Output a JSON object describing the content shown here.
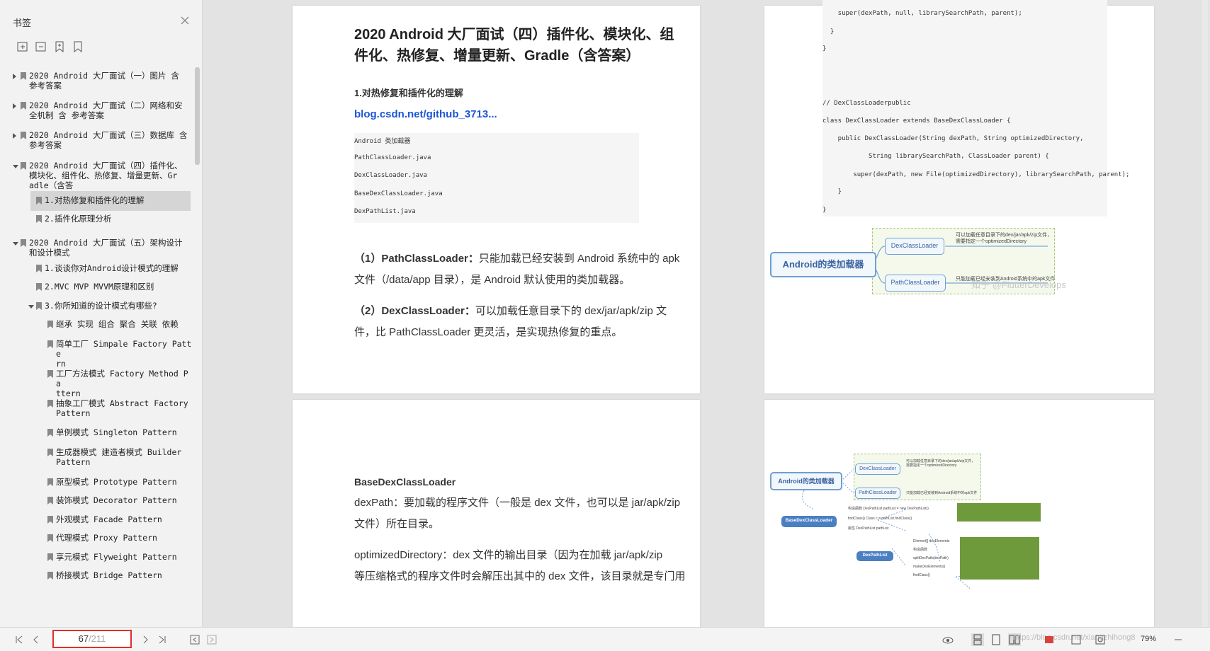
{
  "sidebar": {
    "title": "书签",
    "tools": [
      "expand-all-icon",
      "collapse-all-icon",
      "add-bookmark-icon",
      "bookmark-icon"
    ],
    "items": [
      {
        "text": "2020 Android 大厂面试（一）图片 含\n参考答案",
        "level": 0,
        "arrow": "right"
      },
      {
        "text": "2020 Android 大厂面试（二）网络和安\n全机制 含 参考答案",
        "level": 0,
        "arrow": "right"
      },
      {
        "text": "2020 Android 大厂面试（三）数据库 含\n参考答案",
        "level": 0,
        "arrow": "right"
      },
      {
        "text": "2020 Android 大厂面试（四）插件化、\n模块化、组件化、热修复、增量更新、Gr\nadle（含答",
        "level": 0,
        "arrow": "down"
      },
      {
        "text": "1.对热修复和插件化的理解",
        "level": 1,
        "arrow": "",
        "selected": true
      },
      {
        "text": "2.插件化原理分析",
        "level": 1,
        "arrow": ""
      },
      {
        "text": "2020 Android 大厂面试（五）架构设计\n和设计模式",
        "level": 0,
        "arrow": "down"
      },
      {
        "text": "1.谈谈你对Android设计模式的理解",
        "level": 1,
        "arrow": ""
      },
      {
        "text": "2.MVC MVP MVVM原理和区别",
        "level": 1,
        "arrow": ""
      },
      {
        "text": "3.你所知道的设计模式有哪些?",
        "level": 1,
        "arrow": "down"
      },
      {
        "text": "继承 实现 组合 聚合 关联 依赖",
        "level": 2,
        "arrow": ""
      },
      {
        "text": "简单工厂 Simpale Factory Patte\nrn",
        "level": 2,
        "arrow": ""
      },
      {
        "text": "工厂方法模式 Factory Method Pa\nttern",
        "level": 2,
        "arrow": ""
      },
      {
        "text": "抽象工厂模式 Abstract Factory\nPattern",
        "level": 2,
        "arrow": ""
      },
      {
        "text": "单例模式 Singleton Pattern",
        "level": 2,
        "arrow": ""
      },
      {
        "text": "生成器模式 建造者模式 Builder\nPattern",
        "level": 2,
        "arrow": ""
      },
      {
        "text": "原型模式 Prototype Pattern",
        "level": 2,
        "arrow": ""
      },
      {
        "text": "装饰模式 Decorator Pattern",
        "level": 2,
        "arrow": ""
      },
      {
        "text": "外观模式 Facade Pattern",
        "level": 2,
        "arrow": ""
      },
      {
        "text": "代理模式 Proxy Pattern",
        "level": 2,
        "arrow": ""
      },
      {
        "text": "享元模式 Flyweight Pattern",
        "level": 2,
        "arrow": ""
      },
      {
        "text": "桥接模式 Bridge Pattern",
        "level": 2,
        "arrow": ""
      }
    ]
  },
  "page1": {
    "title_l1": "2020 Android  大厂面试（四）插件化、模块化、组",
    "title_l2": "件化、热修复、增量更新、Gradle（含答案）",
    "section": "1.对热修复和插件化的理解",
    "link": "blog.csdn.net/github_3713...",
    "code": [
      "Android 类加载器",
      "PathClassLoader.java",
      "DexClassLoader.java",
      "BaseDexClassLoader.java",
      "DexPathList.java"
    ],
    "p1_bold": "（1）PathClassLoader：",
    "p1_l1": "只能加载已经安装到 Android 系统中的 apk",
    "p1_l2": "文件（/data/app 目录），是 Android 默认使用的类加载器。",
    "p2_bold": "（2）DexClassLoader：",
    "p2_l1": "可以加载任意目录下的 dex/jar/apk/zip 文",
    "p2_l2": "件，比 PathClassLoader 更灵活，是实现热修复的重点。"
  },
  "page2": {
    "code": [
      "    super(dexPath, null, librarySearchPath, parent);",
      "  }",
      "}",
      "",
      "",
      "// DexClassLoaderpublic",
      "class DexClassLoader extends BaseDexClassLoader {",
      "    public DexClassLoader(String dexPath, String optimizedDirectory,",
      "            String librarySearchPath, ClassLoader parent) {",
      "        super(dexPath, new File(optimizedDirectory), librarySearchPath, parent);",
      "    }",
      "}"
    ],
    "diagram": {
      "root": "Android的类加载器",
      "child1": "DexClassLoader",
      "child2": "PathClassLoader",
      "note1": "可以加载任意目录下的dex/jar/apk/zip文件，\n需要指定一个optimizedDirectory",
      "note2": "只能加载已经安装到Android系统中的apk文件",
      "watermark": "知乎 @FlutterDevelops"
    }
  },
  "page3": {
    "heading": "BaseDexClassLoader",
    "l1": "dexPath：要加载的程序文件（一般是 dex 文件，也可以是 jar/apk/zip",
    "l2": "文件）所在目录。",
    "l3": "optimizedDirectory：dex 文件的输出目录（因为在加载 jar/apk/zip",
    "l4": "等压缩格式的程序文件时会解压出其中的 dex 文件，该目录就是专门用"
  },
  "page4": {
    "root": "Android的类加载器",
    "c1": "DexClassLoader",
    "c2": "PathClassLoader",
    "base": "BaseDexClassLoader",
    "dpl": "DexPathList",
    "n1": "可以加载任意目录下的dex/jar/apk/zip文件，\n需要指定一个optimizedDirectory",
    "n2": "只能加载已经安装到Android系统中的apk文件",
    "m1": "构造函数",
    "m1v": "DexPathList pathList = new DexPathList()",
    "m2": "findClass()",
    "m2v": "Class c = pathList.findClass()",
    "m3": "属性",
    "m3v": "DexPathList pathList",
    "d1": "Element[] dexElements",
    "d2": "构造函数",
    "d3": "splitDexPath(dexPath)",
    "d4": "makeDexElements()",
    "d5": "findClass()"
  },
  "status": {
    "page_current": "67",
    "page_total": "/211",
    "zoom": "79%",
    "watermark": "https://blog.csdn.net/xiangzhihong8"
  }
}
